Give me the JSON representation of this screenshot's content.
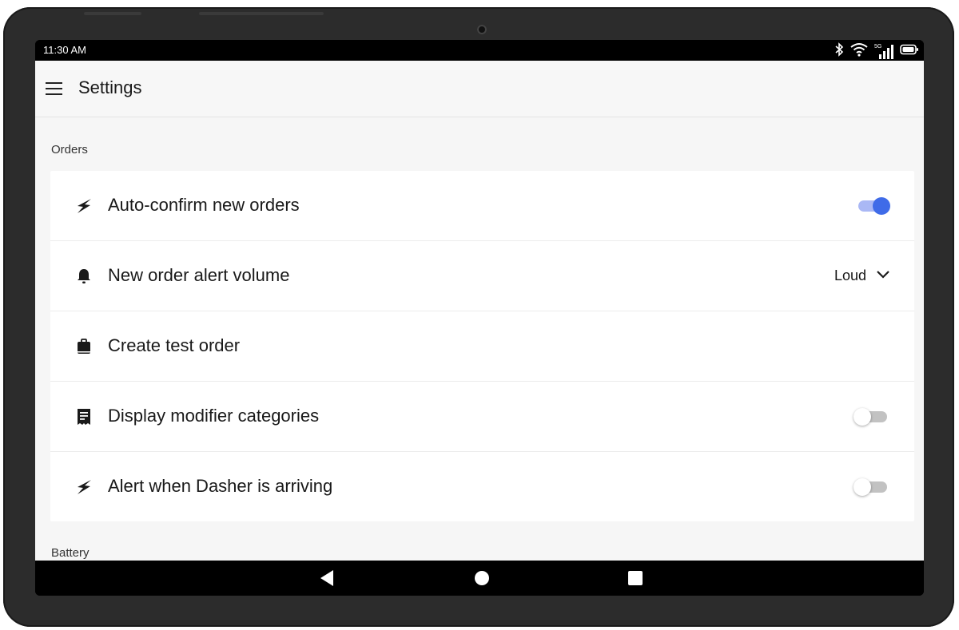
{
  "statusbar": {
    "time": "11:30 AM",
    "icons": [
      "bluetooth-icon",
      "wifi-icon",
      "signal-5g-icon",
      "battery-icon"
    ],
    "network": "5G"
  },
  "appbar": {
    "title": "Settings"
  },
  "sections": {
    "orders": {
      "label": "Orders",
      "rows": [
        {
          "label": "Auto-confirm new orders",
          "icon": "lightning-icon",
          "control": "toggle",
          "on": true
        },
        {
          "label": "New order alert volume",
          "icon": "bell-icon",
          "control": "dropdown",
          "value": "Loud"
        },
        {
          "label": "Create test order",
          "icon": "bag-icon",
          "control": "none"
        },
        {
          "label": "Display modifier categories",
          "icon": "receipt-icon",
          "control": "toggle",
          "on": false
        },
        {
          "label": "Alert when Dasher is arriving",
          "icon": "lightning-icon",
          "control": "toggle",
          "on": false
        }
      ]
    },
    "battery": {
      "label": "Battery"
    }
  },
  "colors": {
    "accent": "#3f6be8",
    "accent_track": "#aab8f5",
    "toggle_off_track": "#c2c2c2",
    "app_bg": "#f6f6f6",
    "card_bg": "#ffffff"
  },
  "navbar": {
    "buttons": [
      "back-icon",
      "home-icon",
      "recents-icon"
    ]
  }
}
